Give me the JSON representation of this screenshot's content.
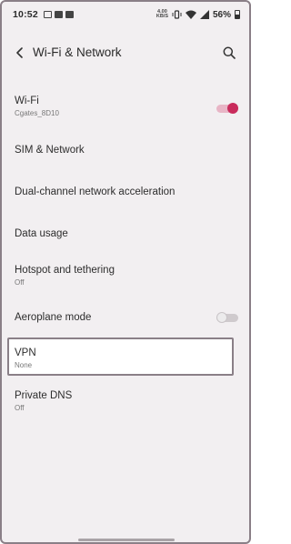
{
  "status_bar": {
    "time": "10:52",
    "net_speed_value": "4.00",
    "net_speed_unit": "KB/S",
    "battery_percent": "56%",
    "icons": [
      "mail-icon",
      "image-icon",
      "image-icon",
      "vibrate-icon",
      "wifi-icon",
      "signal-icon",
      "battery-icon"
    ]
  },
  "header": {
    "title": "Wi-Fi & Network",
    "back_icon": "back-arrow-icon",
    "search_icon": "search-icon"
  },
  "items": [
    {
      "key": "wifi",
      "title": "Wi-Fi",
      "subtitle": "Cgates_8D10",
      "toggle": "on"
    },
    {
      "key": "sim",
      "title": "SIM & Network"
    },
    {
      "key": "dual",
      "title": "Dual-channel network acceleration"
    },
    {
      "key": "data",
      "title": "Data usage"
    },
    {
      "key": "hotspot",
      "title": "Hotspot and tethering",
      "subtitle": "Off"
    },
    {
      "key": "aeroplane",
      "title": "Aeroplane mode",
      "toggle": "off"
    },
    {
      "key": "vpn",
      "title": "VPN",
      "subtitle": "None"
    },
    {
      "key": "dns",
      "title": "Private DNS",
      "subtitle": "Off"
    }
  ],
  "colors": {
    "background": "#f2eff1",
    "accent": "#c92b5c",
    "frame_border": "#8a7f87"
  }
}
